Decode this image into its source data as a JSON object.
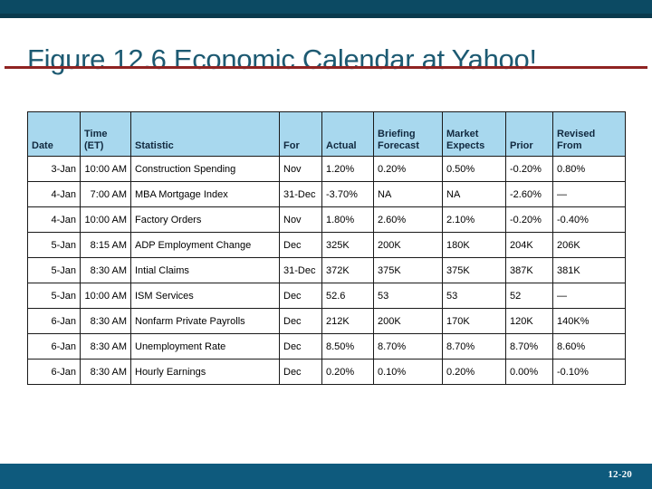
{
  "slide": {
    "title": "Figure 12.6 Economic Calendar at Yahoo!",
    "page_number": "12-20",
    "accent_color": "#0c4a63",
    "rule_color": "#8f2322",
    "title_color": "#1d5a72",
    "footer_color": "#0e5a7d",
    "header_fill_color": "#a8d8ee"
  },
  "table": {
    "columns": [
      {
        "key": "date",
        "label": "Date"
      },
      {
        "key": "time",
        "label": "Time\n(ET)",
        "line1": "Time",
        "line2": "(ET)"
      },
      {
        "key": "statistic",
        "label": "Statistic"
      },
      {
        "key": "for",
        "label": "For"
      },
      {
        "key": "actual",
        "label": "Actual"
      },
      {
        "key": "briefing",
        "label": "Briefing\nForecast",
        "line1": "Briefing",
        "line2": "Forecast"
      },
      {
        "key": "market",
        "label": "Market\nExpects",
        "line1": "Market",
        "line2": "Expects"
      },
      {
        "key": "prior",
        "label": "Prior"
      },
      {
        "key": "revised",
        "label": "Revised\nFrom",
        "line1": "Revised",
        "line2": "From"
      }
    ],
    "rows": [
      {
        "date": "3-Jan",
        "time": "10:00 AM",
        "statistic": "Construction Spending",
        "for": "Nov",
        "actual": "1.20%",
        "briefing": "0.20%",
        "market": "0.50%",
        "prior": "-0.20%",
        "revised": "0.80%"
      },
      {
        "date": "4-Jan",
        "time": "7:00 AM",
        "statistic": "MBA Mortgage Index",
        "for": "31-Dec",
        "actual": "-3.70%",
        "briefing": "NA",
        "market": "NA",
        "prior": "-2.60%",
        "revised": "—"
      },
      {
        "date": "4-Jan",
        "time": "10:00 AM",
        "statistic": "Factory Orders",
        "for": "Nov",
        "actual": "1.80%",
        "briefing": "2.60%",
        "market": "2.10%",
        "prior": "-0.20%",
        "revised": "-0.40%"
      },
      {
        "date": "5-Jan",
        "time": "8:15 AM",
        "statistic": "ADP Employment Change",
        "for": "Dec",
        "actual": "325K",
        "briefing": "200K",
        "market": "180K",
        "prior": "204K",
        "revised": "206K"
      },
      {
        "date": "5-Jan",
        "time": "8:30 AM",
        "statistic": "Intial Claims",
        "for": "31-Dec",
        "actual": "372K",
        "briefing": "375K",
        "market": "375K",
        "prior": "387K",
        "revised": "381K"
      },
      {
        "date": "5-Jan",
        "time": "10:00 AM",
        "statistic": "ISM Services",
        "for": "Dec",
        "actual": "52.6",
        "briefing": "53",
        "market": "53",
        "prior": "52",
        "revised": "—"
      },
      {
        "date": "6-Jan",
        "time": "8:30 AM",
        "statistic": "Nonfarm Private Payrolls",
        "for": "Dec",
        "actual": "212K",
        "briefing": "200K",
        "market": "170K",
        "prior": "120K",
        "revised": "140K%"
      },
      {
        "date": "6-Jan",
        "time": "8:30 AM",
        "statistic": "Unemployment Rate",
        "for": "Dec",
        "actual": "8.50%",
        "briefing": "8.70%",
        "market": "8.70%",
        "prior": "8.70%",
        "revised": "8.60%"
      },
      {
        "date": "6-Jan",
        "time": "8:30 AM",
        "statistic": "Hourly Earnings",
        "for": "Dec",
        "actual": "0.20%",
        "briefing": "0.10%",
        "market": "0.20%",
        "prior": "0.00%",
        "revised": "-0.10%"
      }
    ]
  }
}
